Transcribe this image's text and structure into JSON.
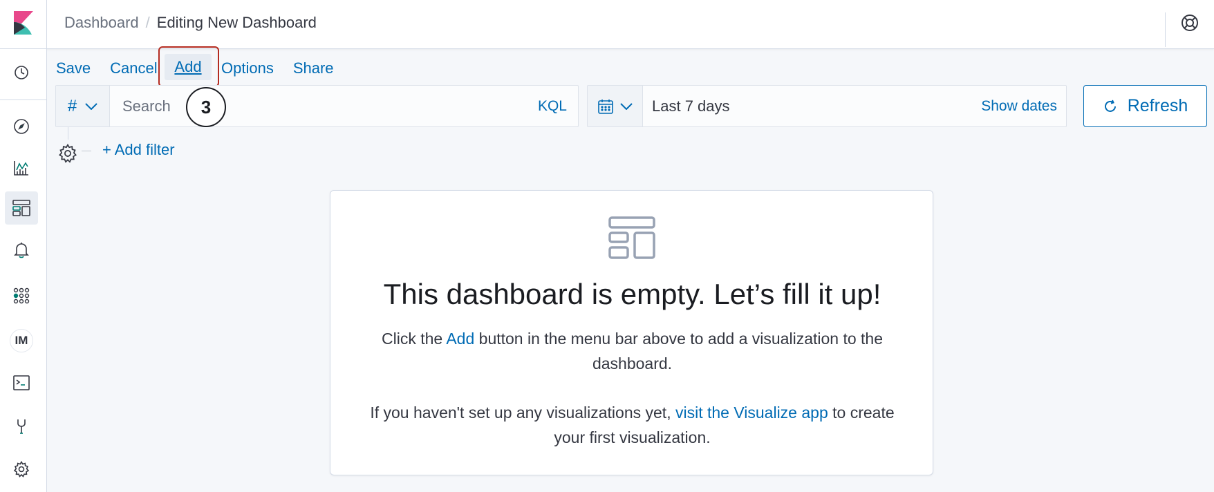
{
  "header": {
    "breadcrumb_parent": "Dashboard",
    "breadcrumb_separator": "/",
    "breadcrumb_current": "Editing New Dashboard"
  },
  "sidebar": {
    "items": [
      {
        "icon": "clock-icon"
      },
      {
        "icon": "compass-icon"
      },
      {
        "icon": "visualize-icon"
      },
      {
        "icon": "dashboard-icon",
        "active": true
      },
      {
        "icon": "bell-icon"
      },
      {
        "icon": "apps-grid-icon"
      },
      {
        "icon": "im-badge",
        "label": "IM"
      },
      {
        "icon": "console-icon"
      },
      {
        "icon": "wrench-icon"
      },
      {
        "icon": "gear-icon"
      }
    ]
  },
  "menu": {
    "save": "Save",
    "cancel": "Cancel",
    "add": "Add",
    "options": "Options",
    "share": "Share"
  },
  "query": {
    "index_symbol": "#",
    "placeholder": "Search",
    "language": "KQL",
    "step_badge": "3"
  },
  "date": {
    "range": "Last 7 days",
    "show_dates": "Show dates",
    "refresh": "Refresh"
  },
  "filters": {
    "add_filter": "+ Add filter"
  },
  "empty": {
    "title": "This dashboard is empty. Let’s fill it up!",
    "line1_pre": "Click the ",
    "line1_link": "Add",
    "line1_post": " button in the menu bar above to add a visualization to the dashboard.",
    "line2_pre": "If you haven't set up any visualizations yet, ",
    "line2_link": "visit the Visualize app",
    "line2_post": " to create your first visualization."
  },
  "colors": {
    "link": "#006bb4",
    "highlight": "#b42b20",
    "logo_pink": "#e8488b",
    "logo_teal": "#3ebeb0",
    "logo_dark": "#343741"
  }
}
